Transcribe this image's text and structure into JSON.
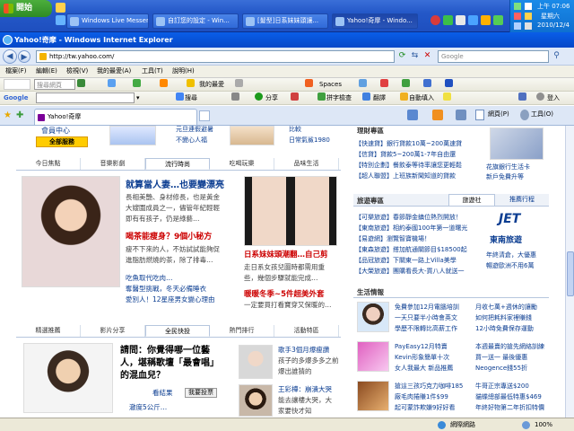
{
  "taskbar": {
    "start_label": "開始",
    "windows": [
      "Windows Live Messen...",
      "自訂您的設定 - Win...",
      "[髮型]日系妹妹頭讓...",
      "Yahoo!奇摩 - Windo..."
    ],
    "clock_time": "上午 07:06",
    "clock_day": "星期六",
    "clock_date": "2010/12/4"
  },
  "window": {
    "title": "Yahoo!奇摩 - Windows Internet Explorer",
    "address": "http://tw.yahoo.com/",
    "search_placeholder": "Google"
  },
  "menu": [
    "檔案(F)",
    "編輯(E)",
    "檢視(V)",
    "我的最愛(A)",
    "工具(T)",
    "說明(H)"
  ],
  "toolbar1": {
    "search_placeholder": "搜尋網頁",
    "favorites": "我的最愛",
    "spaces": "Spaces"
  },
  "toolbar2": {
    "brand": "Google",
    "search": "搜尋",
    "share": "分享",
    "spell": "拼字檢查",
    "translate": "翻譯",
    "autofill": "自動填入",
    "login": "登入"
  },
  "tab": {
    "label": "Yahoo!奇摩",
    "page_menu": "網頁(P)",
    "tools_menu": "工具(O)"
  },
  "content": {
    "top_left": {
      "line1": "會員中心",
      "button": "全部服務"
    },
    "top_mid": {
      "line1": "元旦連假避暑",
      "line2": "不變心人福",
      "line3": "比較",
      "line4": "日常氣鯊1980"
    },
    "news_tabs": [
      "今日焦點",
      "音樂影劇",
      "流行時尚",
      "吃喝玩樂",
      "品味生活"
    ],
    "news_active": "流行時尚",
    "feature1": {
      "title": "就算當人妻…也要變漂亮",
      "body": [
        "長相美艷、身材修長，也是黃金",
        "大嫂圍成員之一，儘管年紀輕輕",
        "即有有孩子，仍是綠藝…"
      ],
      "link": "喝茶能瘦身？9個小秘方",
      "link_body": [
        "瘦不下來的人，不妨試試能夠促",
        "進脂肪燃燒的茶，除了排毒…"
      ],
      "bullets": [
        "吃魚取代吃肉…",
        "輕鬆學瘦身小秘訣",
        "奪醫型挑戰，冬天必備睡衣",
        "愛別人！12星座男女變心理由"
      ]
    },
    "feature2": {
      "title": "日系妹妹頭潮翻…自己剪",
      "body": [
        "走日系女孩兒圖時都需用重",
        "些，幾個步驟就能完成…"
      ],
      "link": "暖暖冬季~5件超美外套",
      "link_body": [
        "一定要買打看寶穿又保暖的…"
      ]
    },
    "right": {
      "finance_hdr": "理財專區",
      "finance": [
        "【快速貸】銀行貸款10萬~200萬速貸",
        "【信貸】貸款5~200萬1-7年自由還",
        "【特別企劃】餐飲泰等待率讓您更輕鬆",
        "【超人聯盟】上班族新聞知道的貸款"
      ],
      "card": "花旗銀行生活卡",
      "card_sub": "新戶免費升等",
      "travel_hdr": "旅遊專區",
      "travel_tabs": [
        "旅遊社",
        "推薦行程"
      ],
      "travel": [
        "【可樂旅遊】春節靜金鎮位熱烈開放！",
        "【東南旅遊】相約泰國100年第一道曙光",
        "【易遊網】瀏覽智寶機場！",
        "【東森旅遊】搭加航通關節目$18500起",
        "【品冠旅遊】下關東一路上Villa美學",
        "【大榮旅遊】團購看長大-買八人就送一"
      ],
      "jet": "東南旅遊",
      "jet_sub1": "年終清倉，大優惠",
      "jet_sub2": "暢遊歐洲不用6萬",
      "life_hdr": "生活情報",
      "life": [
        [
          "免費參加12月電腦培訓",
          "一天只要半小時會英文",
          "學歷不限轉比高薪工作"
        ],
        [
          "月收七萬+週休的讓勵",
          "如何把耗料家裡賺錢",
          "12小時免費保存運動"
        ],
        [
          "PayEasy12月特賣",
          "Kevin形象簡單十次",
          "女人我最大 新品推薦"
        ],
        [
          "本週最賣的搶先網絡訓練",
          "買一送一 最後優惠",
          "Neogence錢55折"
        ],
        [
          "搶這三孩巧克力咖啡185",
          "廠毛肉捲賺1件$99",
          "起可蒙詐欺嫌9好好看"
        ],
        [
          "牛哥正宗專送$200",
          "貓蝶總部最低特惠$469",
          "年終好物第二年折扣特價"
        ]
      ]
    },
    "bottom_tabs": [
      "精選推薦",
      "影片分享",
      "全民快投",
      "熱門排行",
      "活動特區"
    ],
    "bottom_active": "全民快投",
    "poll": {
      "title": [
        "請問：你覺得哪一位藝",
        "人，堪稱歌壇「最會唱」",
        "的混血兒？"
      ],
      "result": "看結果",
      "vote": "我要投票",
      "link": "澈度5公斤…"
    },
    "bottom_right": [
      [
        "歌手3個月爆瘦讚",
        "孩子的多爆多多之前",
        "爆出誰猜的"
      ],
      [
        "王彩樺：崩潰大哭",
        "能去讓樓大哭，大",
        "家要快才知"
      ]
    ]
  },
  "status": {
    "zone": "網際網路",
    "zoom": "100%"
  },
  "colors": {
    "taskbar": "#2458c8",
    "title": "#0447c8",
    "link_blue": "#0b3d91",
    "accent_red": "#c00000",
    "yahoo_purple": "#7b0099"
  }
}
